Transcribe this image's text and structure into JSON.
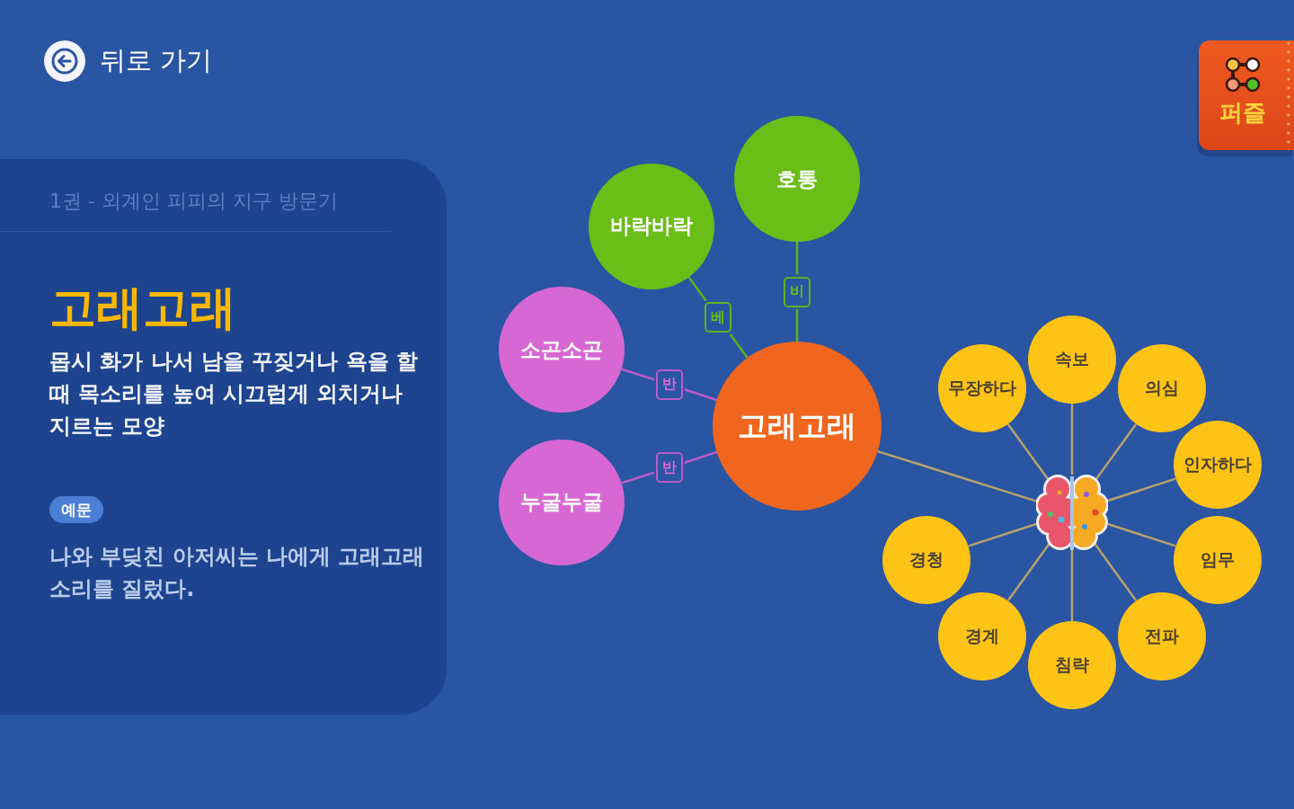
{
  "back_button": {
    "label": "뒤로 가기"
  },
  "puzzle_tab": {
    "label": "퍼즐"
  },
  "word_card": {
    "book": "1권 - 외계인 피피의 지구 방문기",
    "word": "고래고래",
    "definition": "몹시 화가 나서 남을 꾸짖거나 욕을 할 때 목소리를 높여 시끄럽게 외치거나 지르는 모양",
    "example_tag": "예문",
    "example": "나와 부딪친 아저씨는 나에게 고래고래 소리를 질렀다."
  },
  "word_map": {
    "center": {
      "label": "고래고래"
    },
    "relations": [
      {
        "word": "호통",
        "relation": "비",
        "kind": "synonym"
      },
      {
        "word": "바락바락",
        "relation": "베",
        "kind": "synonym"
      },
      {
        "word": "소곤소곤",
        "relation": "반",
        "kind": "antonym"
      },
      {
        "word": "누굴누굴",
        "relation": "반",
        "kind": "antonym"
      }
    ],
    "topic_words": [
      "속보",
      "의심",
      "인자하다",
      "임무",
      "전파",
      "침략",
      "경계",
      "경청",
      "무장하다"
    ]
  }
}
